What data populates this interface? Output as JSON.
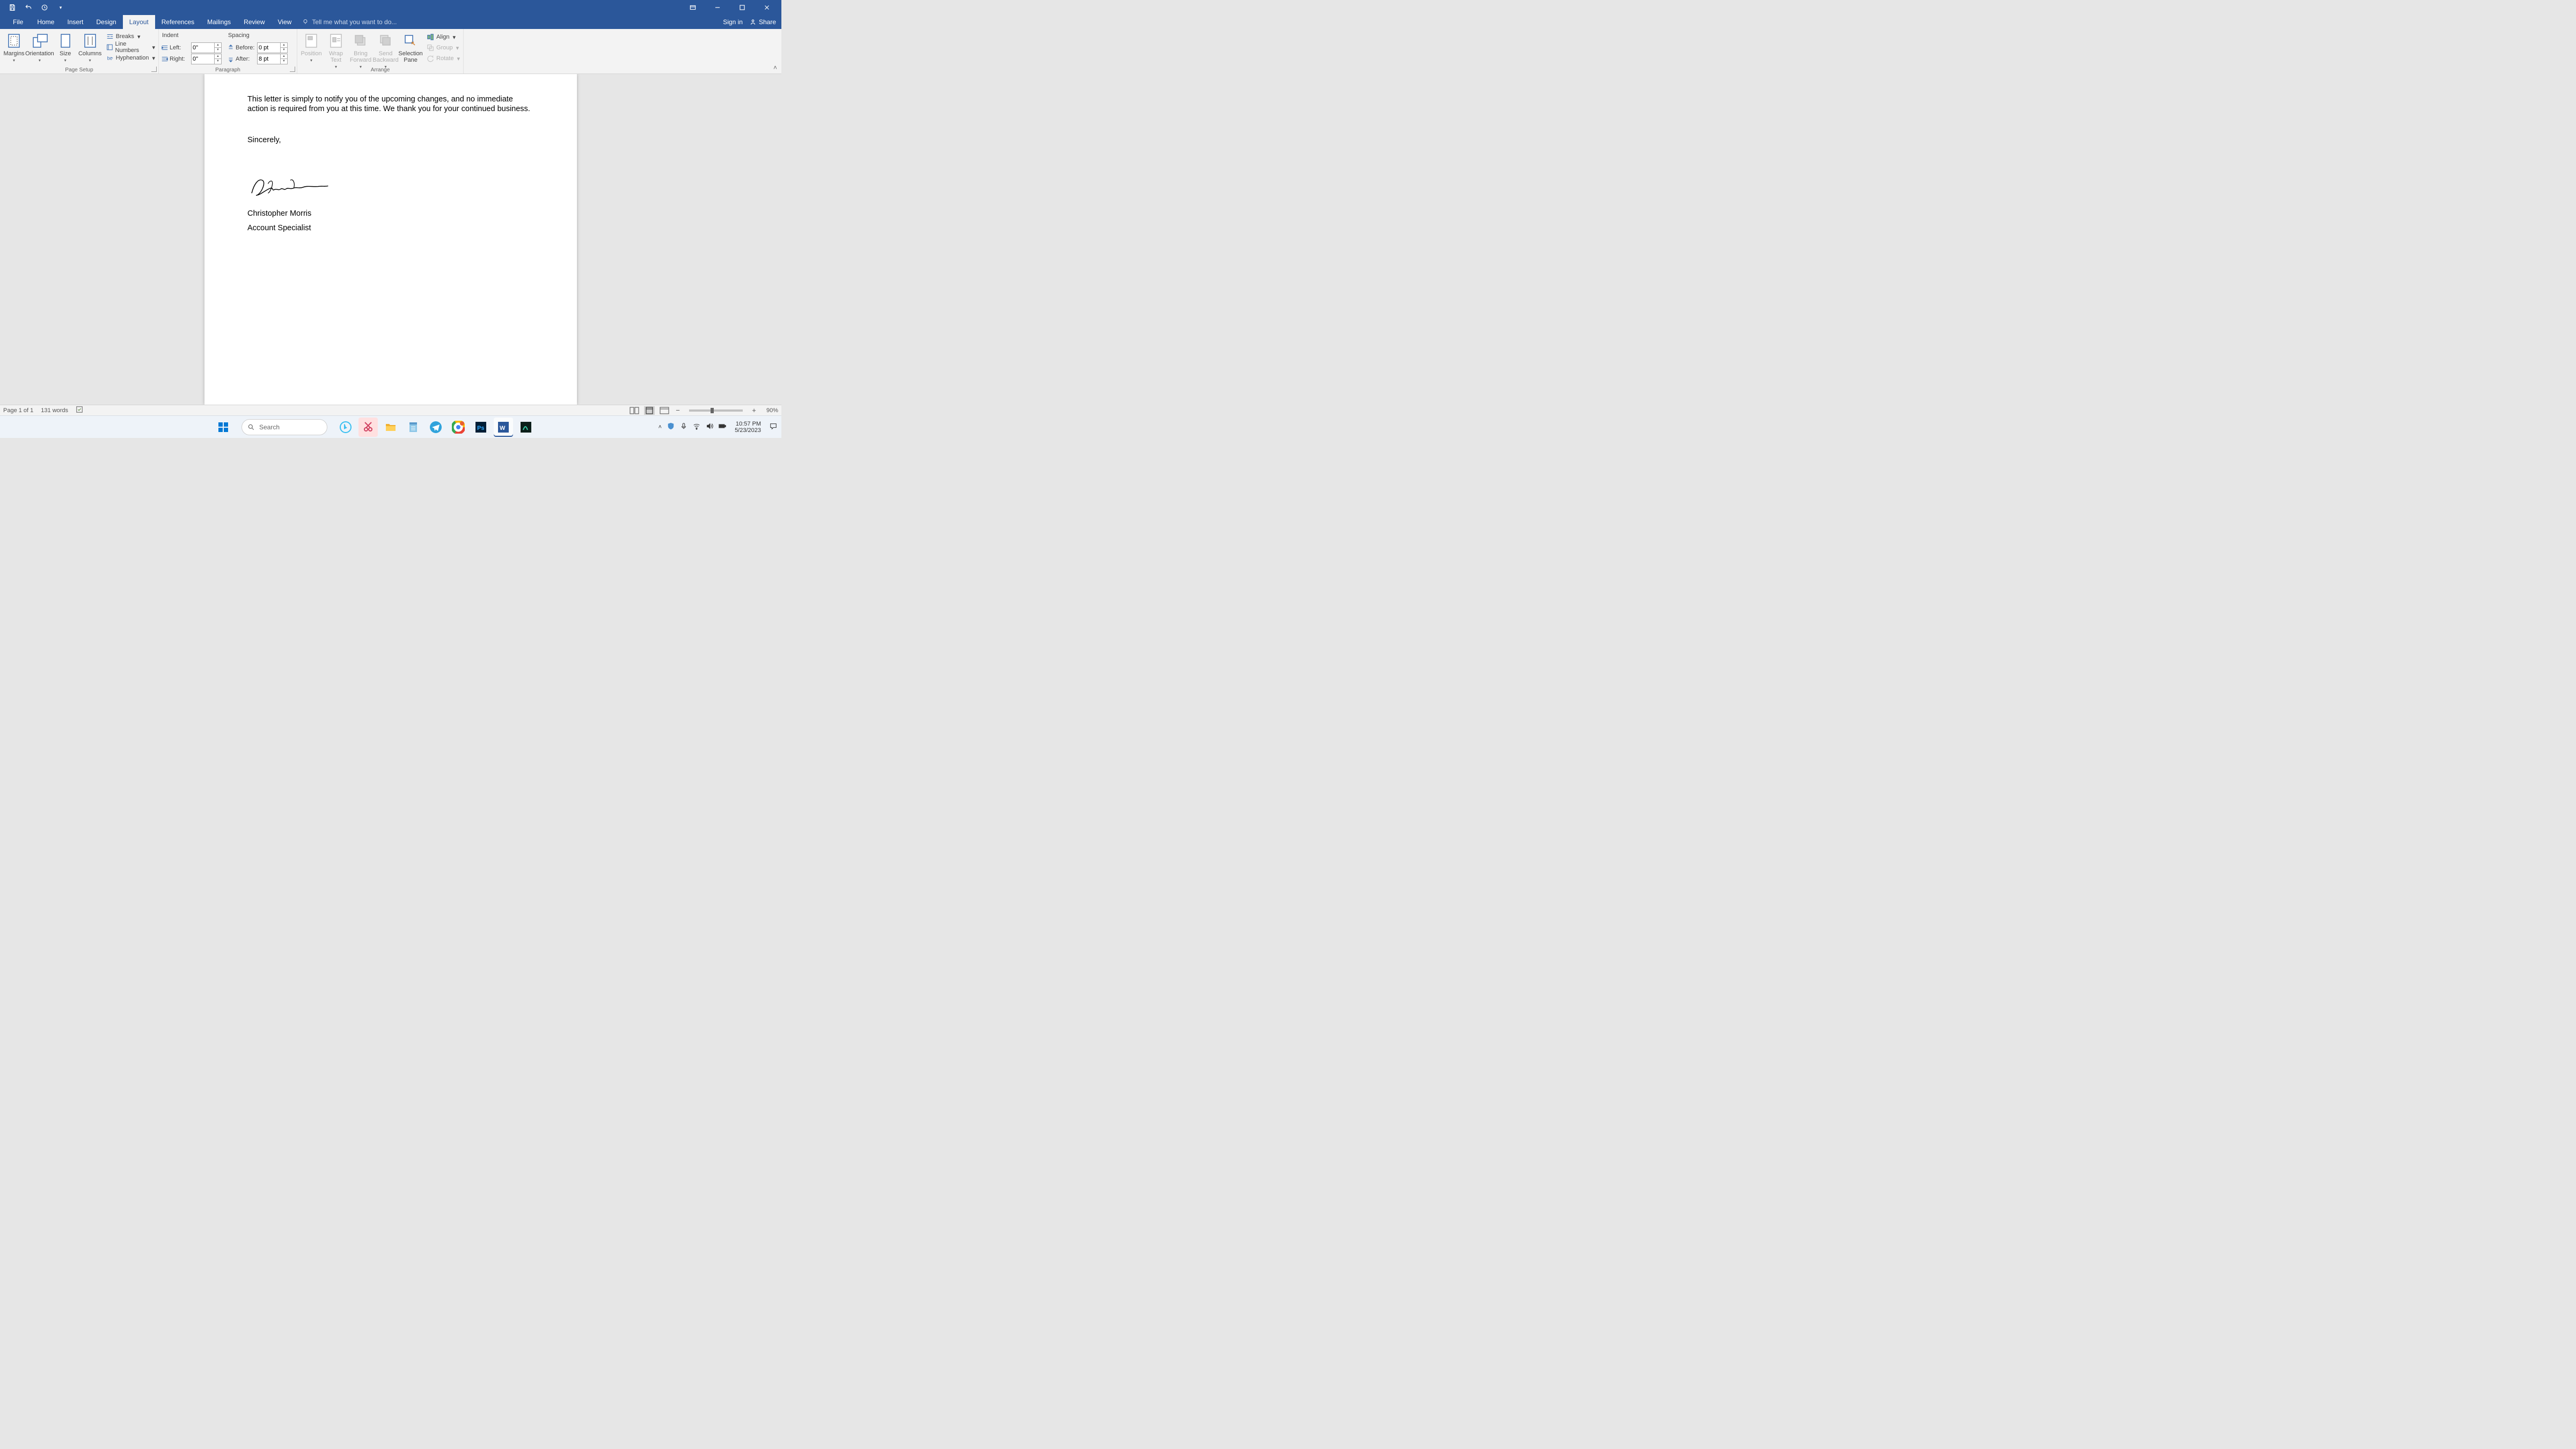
{
  "qat": {
    "save": "Save",
    "undo": "Undo",
    "redo": "Redo"
  },
  "window": {
    "signin": "Sign in",
    "share": "Share"
  },
  "tabs": {
    "file": "File",
    "home": "Home",
    "insert": "Insert",
    "design": "Design",
    "layout": "Layout",
    "references": "References",
    "mailings": "Mailings",
    "review": "Review",
    "view": "View",
    "tellme": "Tell me what you want to do..."
  },
  "ribbon": {
    "page_setup": {
      "label": "Page Setup",
      "margins": "Margins",
      "orientation": "Orientation",
      "size": "Size",
      "columns": "Columns",
      "breaks": "Breaks",
      "line_numbers": "Line Numbers",
      "hyphenation": "Hyphenation"
    },
    "paragraph": {
      "label": "Paragraph",
      "indent_label": "Indent",
      "spacing_label": "Spacing",
      "left_label": "Left:",
      "right_label": "Right:",
      "before_label": "Before:",
      "after_label": "After:",
      "left_val": "0\"",
      "right_val": "0\"",
      "before_val": "0 pt",
      "after_val": "8 pt"
    },
    "arrange": {
      "label": "Arrange",
      "position": "Position",
      "wrap": "Wrap\nText",
      "bring": "Bring\nForward",
      "send": "Send\nBackward",
      "selection": "Selection\nPane",
      "align": "Align",
      "group": "Group",
      "rotate": "Rotate"
    }
  },
  "document": {
    "para1": "This letter is simply to notify you of the upcoming changes, and no immediate action is required from you at this time. We thank you for your continued business.",
    "sincerely": "Sincerely,",
    "name": "Christopher Morris",
    "title": "Account Specialist"
  },
  "status": {
    "page": "Page 1 of 1",
    "words": "131 words",
    "zoom": "90%"
  },
  "taskbar": {
    "search": "Search",
    "time": "10:57 PM",
    "date": "5/23/2023"
  }
}
